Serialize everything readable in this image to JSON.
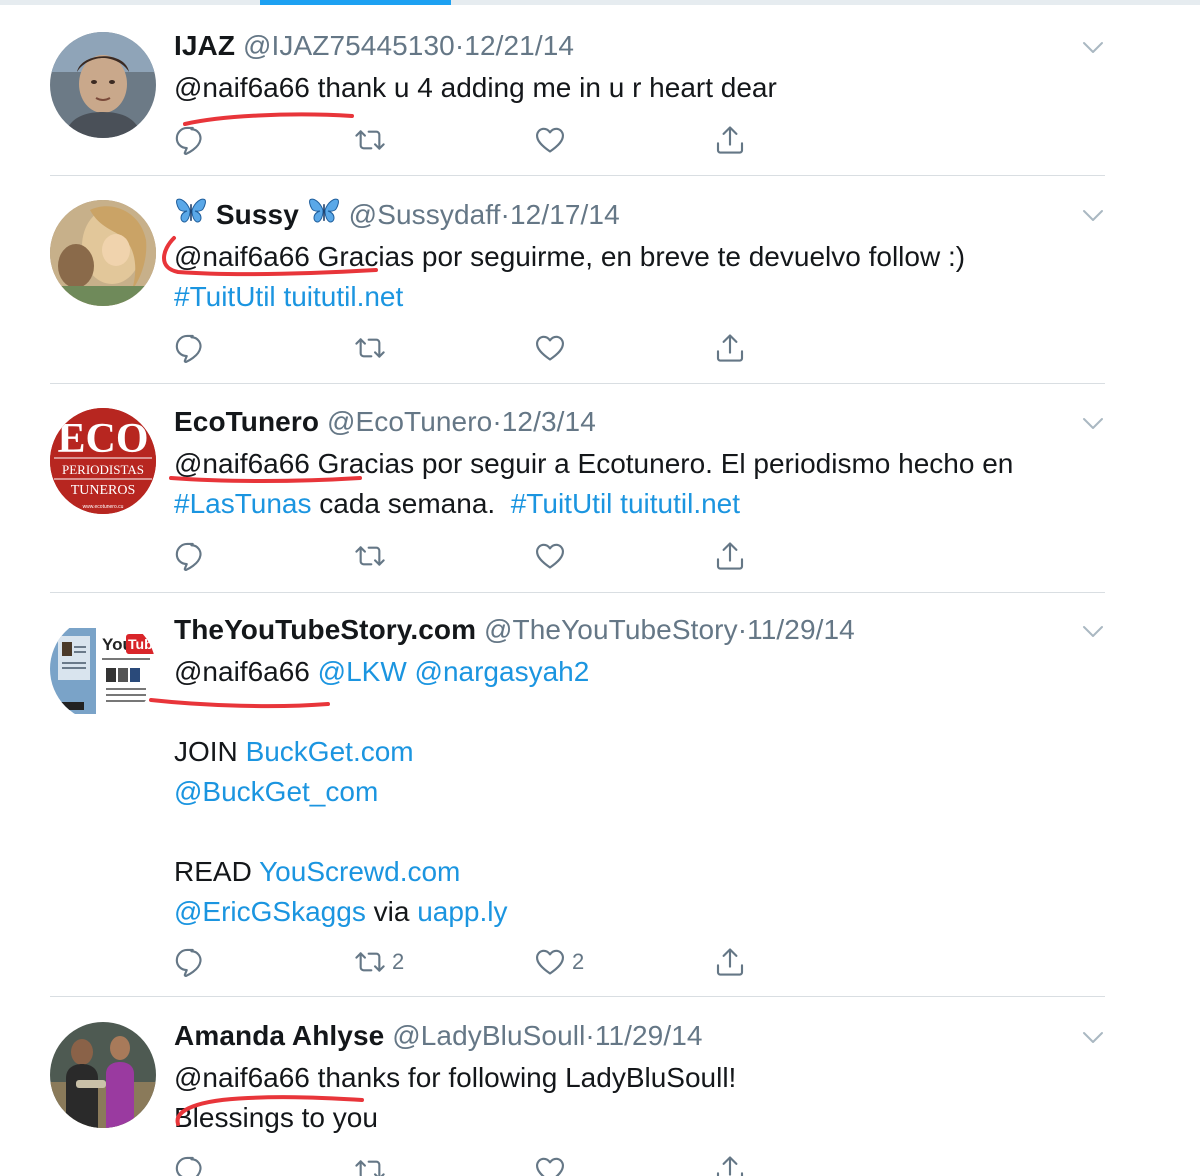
{
  "tweets": [
    {
      "name": "IJAZ",
      "handle": "@IJAZ75445130",
      "separator": "·",
      "date": "12/21/14",
      "body": {
        "mention": "@naif6a66",
        "text": " thank u 4 adding me in u r heart dear"
      },
      "actions": {
        "reply_count": "",
        "retweet_count": "",
        "like_count": ""
      }
    },
    {
      "name": "Sussy",
      "handle": "@Sussydaff",
      "separator": "·",
      "date": "12/17/14",
      "body": {
        "mention": "@naif6a66",
        "text": " Gracias por seguirme, en breve te devuelvo follow :)",
        "hashtag": "#TuitUtil",
        "link": "tuitutil.net"
      },
      "actions": {
        "reply_count": "",
        "retweet_count": "",
        "like_count": ""
      }
    },
    {
      "name": "EcoTunero",
      "handle": "@EcoTunero",
      "separator": "·",
      "date": "12/3/14",
      "avatar_text": {
        "line1": "ECO",
        "line2": "PERIODISTAS",
        "line3": "TUNEROS",
        "line4": "www.ecotunero.cu"
      },
      "body": {
        "mention": "@naif6a66",
        "text": " Gracias por seguir a Ecotunero. El periodismo hecho en",
        "hashtag1": "#LasTunas",
        "text2": " cada semana. ",
        "hashtag2": "#TuitUtil",
        "link": "tuitutil.net"
      },
      "actions": {
        "reply_count": "",
        "retweet_count": "",
        "like_count": ""
      }
    },
    {
      "name": "TheYouTubeStory.com",
      "handle": "@TheYouTubeStory",
      "separator": "·",
      "date": "11/29/14",
      "avatar_text": {
        "you": "You",
        "tube": "Tube"
      },
      "body": {
        "mention": "@naif6a66",
        "mention2": "@LKW",
        "mention3": "@nargasyah2",
        "join": "JOIN ",
        "join_link": "BuckGet.com",
        "buckget_handle": "@BuckGet_com",
        "read": "READ ",
        "read_link": "YouScrewd.com",
        "eric": "@EricGSkaggs",
        "via": " via ",
        "via_link": "uapp.ly"
      },
      "actions": {
        "reply_count": "",
        "retweet_count": "2",
        "like_count": "2"
      }
    },
    {
      "name": "Amanda Ahlyse",
      "handle": "@LadyBluSoull",
      "separator": "·",
      "date": "11/29/14",
      "body": {
        "mention": "@naif6a66",
        "text": " thanks for following LadyBluSoull!",
        "line2": "Blessings to you"
      },
      "actions": {
        "reply_count": "",
        "retweet_count": "",
        "like_count": ""
      }
    }
  ],
  "icons": {
    "reply": "reply-icon",
    "retweet": "retweet-icon",
    "like": "heart-icon",
    "share": "share-icon",
    "caret": "chevron-down-icon",
    "butterfly": "butterfly-emoji"
  },
  "colors": {
    "link": "#1b95e0",
    "secondary_text": "#657786",
    "icon": "#657786",
    "tab_indicator": "#1da1f2",
    "annotation": "#e8353a"
  }
}
